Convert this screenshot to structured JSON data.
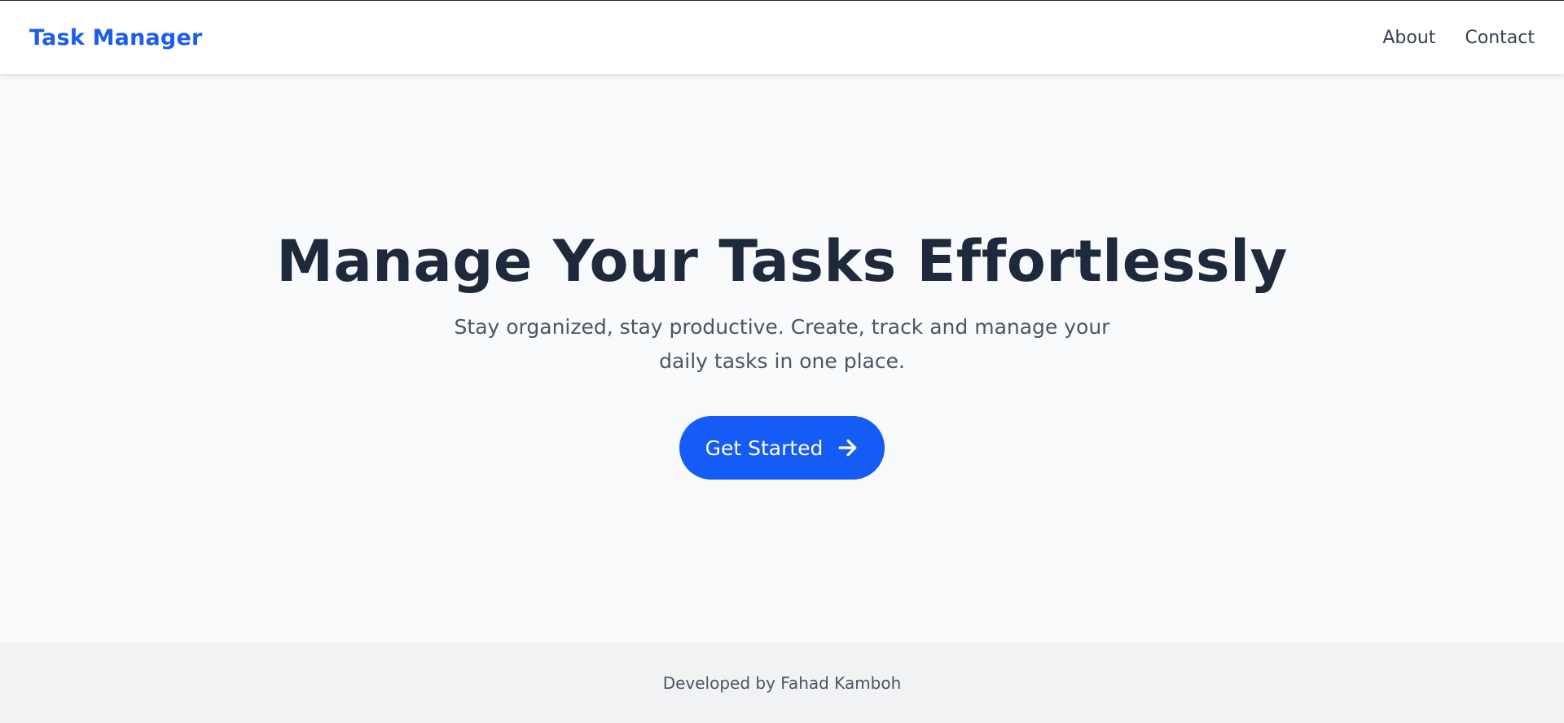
{
  "header": {
    "brand": "Task Manager",
    "nav": [
      {
        "label": "About"
      },
      {
        "label": "Contact"
      }
    ]
  },
  "hero": {
    "title": "Manage Your Tasks Effortlessly",
    "subtitle": "Stay organized, stay productive. Create, track and manage your daily tasks in one place.",
    "cta_label": "Get Started",
    "cta_icon": "arrow-right-icon"
  },
  "footer": {
    "text": "Developed by Fahad Kamboh"
  },
  "colors": {
    "brand": "#1d5de8",
    "cta_background": "#155bf5",
    "heading": "#1e293b",
    "page_background": "#f8fafc",
    "footer_background": "#f1f2f4"
  }
}
